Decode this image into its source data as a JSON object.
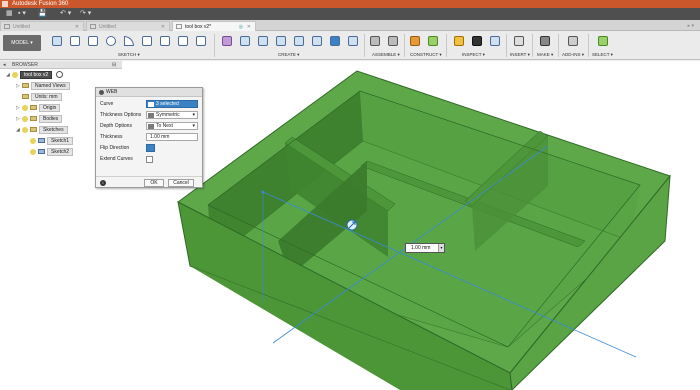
{
  "app": {
    "title": "Autodesk Fusion 360"
  },
  "quick_access": {
    "file_menu": "▪ ▾",
    "save": "💾",
    "undo": "↶ ▾",
    "redo": "↷ ▾"
  },
  "tabs": [
    {
      "label": "Untitled"
    },
    {
      "label": "Untitled"
    },
    {
      "label": "tool box v2*"
    }
  ],
  "ribbon": {
    "mode": "MODEL ▾",
    "groups": {
      "sketch": "SKETCH ▾",
      "create": "CREATE ▾",
      "assemble": "ASSEMBLE ▾",
      "construct": "CONSTRUCT ▾",
      "inspect": "INSPECT ▾",
      "insert": "INSERT ▾",
      "make": "MAKE ▾",
      "addins": "ADD-INS ▾",
      "select": "SELECT ▾"
    }
  },
  "browser": {
    "header": "BROWSER",
    "root": "tool box v2",
    "items": [
      {
        "label": "Named Views"
      },
      {
        "label": "Units: mm"
      },
      {
        "label": "Origin"
      },
      {
        "label": "Bodies"
      },
      {
        "label": "Sketches"
      },
      {
        "label": "Sketch1"
      },
      {
        "label": "Sketch2"
      }
    ]
  },
  "dialog": {
    "title": "WEB",
    "rows": {
      "curve_label": "Curve",
      "curve_value": "3 selected",
      "thickness_options_label": "Thickness Options",
      "thickness_options_value": "Symmetric",
      "depth_options_label": "Depth Options",
      "depth_options_value": "To Next",
      "thickness_label": "Thickness",
      "thickness_value": "1.00 mm",
      "flip_label": "Flip Direction",
      "extend_label": "Extend Curves"
    },
    "ok": "OK",
    "cancel": "Cancel"
  },
  "canvas_input": {
    "value": "1.00 mm"
  },
  "colors": {
    "body_green": "#4e9a3a",
    "titlebar": "#c9572b",
    "selection_blue": "#3b82c4"
  }
}
